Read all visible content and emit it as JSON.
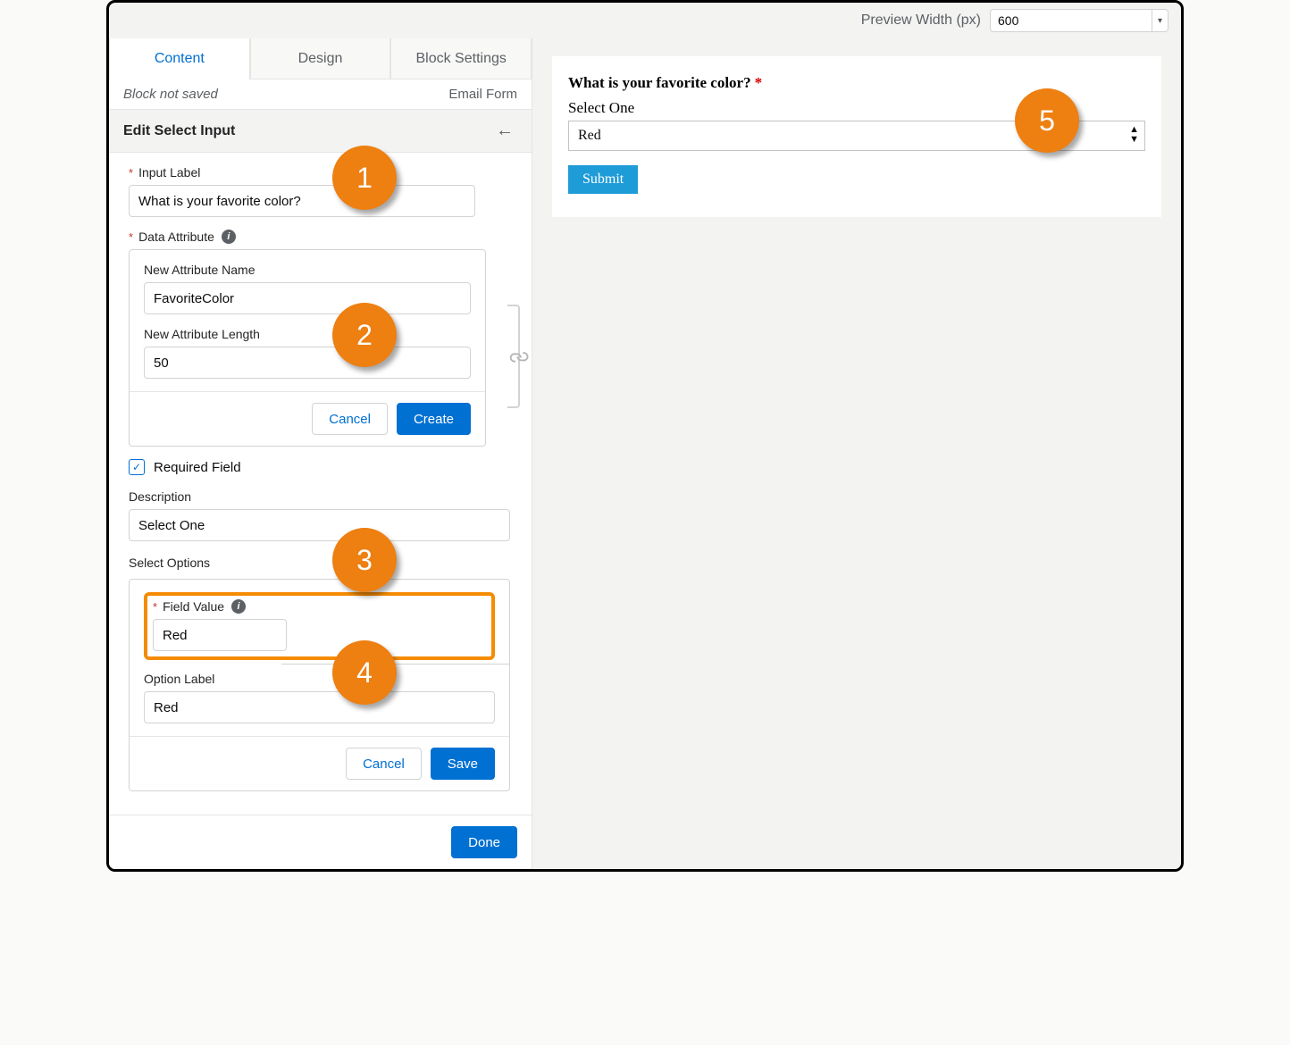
{
  "topbar": {
    "preview_width_label": "Preview Width (px)",
    "preview_width_value": "600"
  },
  "tabs": {
    "content": "Content",
    "design": "Design",
    "block_settings": "Block Settings"
  },
  "status": {
    "not_saved": "Block not saved",
    "block_type": "Email Form"
  },
  "panel": {
    "title": "Edit Select Input",
    "labels": {
      "input_label": "Input Label",
      "data_attribute": "Data Attribute",
      "new_attribute_name": "New Attribute Name",
      "new_attribute_length": "New Attribute Length",
      "required_field": "Required Field",
      "description": "Description",
      "select_options": "Select Options",
      "field_value": "Field Value",
      "option_label": "Option Label"
    },
    "values": {
      "input_label": "What is your favorite color?",
      "new_attribute_name": "FavoriteColor",
      "new_attribute_length": "50",
      "description": "Select One",
      "field_value": "Red",
      "option_label": "Red"
    },
    "buttons": {
      "cancel": "Cancel",
      "create": "Create",
      "save": "Save",
      "done": "Done"
    }
  },
  "preview": {
    "question": "What is your favorite color?",
    "description": "Select One",
    "selected": "Red",
    "submit": "Submit"
  },
  "callouts": {
    "c1": "1",
    "c2": "2",
    "c3": "3",
    "c4": "4",
    "c5": "5"
  }
}
